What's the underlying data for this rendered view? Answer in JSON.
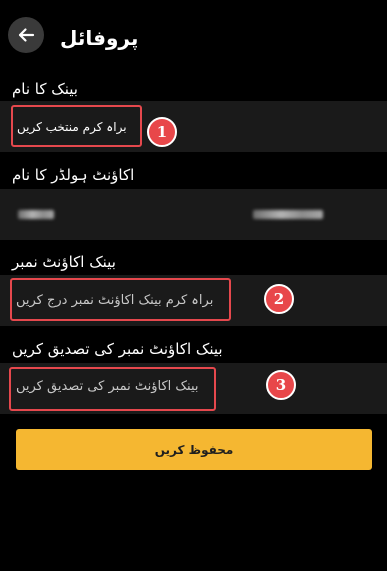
{
  "header": {
    "title": "پروفائل",
    "back_icon": "arrow-left-icon"
  },
  "form": {
    "bank_name": {
      "label": "بینک کا نام",
      "value": "براہ کرم منتخب کریں",
      "annotation": "1"
    },
    "account_holder": {
      "label": "اکاؤنٹ ہولڈر کا نام"
    },
    "account_number": {
      "label": "بینک اکاؤنٹ نمبر",
      "placeholder": "براہ کرم بینک اکاؤنٹ نمبر درج کریں",
      "annotation": "2"
    },
    "confirm_account_number": {
      "label": "بینک اکاؤنٹ نمبر کی تصدیق کریں",
      "placeholder": "بینک اکاؤنٹ نمبر کی تصدیق کریں",
      "annotation": "3"
    }
  },
  "save_button": {
    "label": "محفوظ کریں"
  },
  "colors": {
    "background": "#000000",
    "field_band": "#1a1a1a",
    "accent": "#f5b731",
    "annotation_red": "#e5484d"
  }
}
